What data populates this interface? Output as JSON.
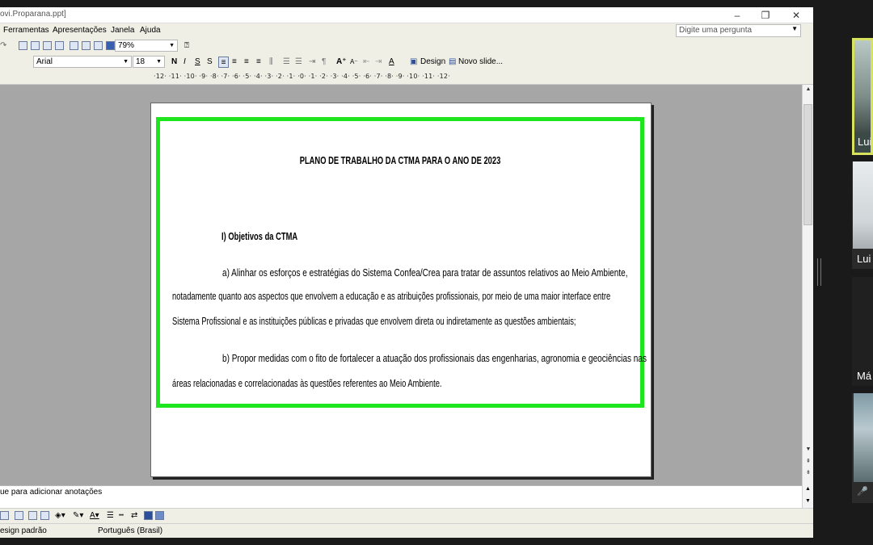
{
  "window": {
    "title": "ovi.Proparana.ppt]",
    "min_glyph": "‒",
    "restore_glyph": "❐",
    "close_glyph": "✕"
  },
  "menu": {
    "items": [
      "Ferramentas",
      "Apresentações",
      "Janela",
      "Ajuda"
    ],
    "ask_placeholder": "Digite uma pergunta"
  },
  "toolbar": {
    "zoom": "79%",
    "font_name": "Arial",
    "font_size": "18",
    "bold": "N",
    "italic": "I",
    "underline": "S",
    "shadow": "S",
    "design_label": "Design",
    "new_slide_label": "Novo slide..."
  },
  "ruler": {
    "text": "·12·  ·11·  ·10·  ·9·  ·8·  ·7·  ·6·  ·5·  ·4·  ·3·  ·2·  ·1·  ·0·  ·1·  ·2·  ·3·  ·4·  ·5·  ·6·  ·7·  ·8·  ·9·  ·10·  ·11·  ·12·"
  },
  "slide": {
    "title": "PLANO DE TRABALHO DA CTMA PARA O ANO DE 2023",
    "heading": "I) Objetivos da CTMA",
    "para_a_line1": "a) Alinhar os esforços e estratégias do Sistema Confea/Crea para tratar de assuntos relativos ao Meio Ambiente,",
    "para_a_line2": "notadamente quanto aos aspectos que envolvem a educação e as atribuições profissionais, por meio de uma maior interface entre",
    "para_a_line3": "Sistema Profissional e as instituições públicas e privadas que envolvem direta ou indiretamente as questões ambientais;",
    "para_b_line1": "b) Propor medidas com o fito de fortalecer a atuação dos profissionais das engenharias, agronomia e geociências nas",
    "para_b_line2": "áreas relacionadas e correlacionadas às questões referentes ao Meio Ambiente.",
    "frame_color": "#1ee61e"
  },
  "notes": {
    "text": "ue para adicionar anotações"
  },
  "status": {
    "design": "esign padrão",
    "language": "Português (Brasil)"
  },
  "participants": [
    {
      "name": "Lui",
      "active_color": "#d8e25e"
    },
    {
      "name": "Lui"
    },
    {
      "name": "Má"
    },
    {
      "name": ""
    }
  ]
}
